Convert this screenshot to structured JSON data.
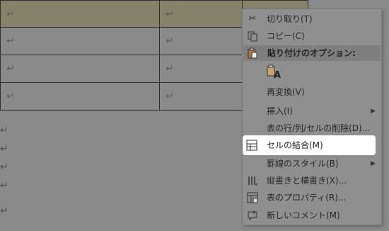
{
  "document": {
    "paragraph_mark": "↵"
  },
  "context_menu": {
    "cut": "切り取り(T)",
    "copy": "コピー(C)",
    "paste_options_header": "貼り付けのオプション:",
    "paste_option_icon": "A",
    "reconvert": "再変換(V)",
    "insert": "挿入(I)",
    "delete_table_parts": "表の行/列/セルの削除(D)...",
    "merge_cells": "セルの結合(M)",
    "border_styles": "罫線のスタイル(B)",
    "text_direction": "縦書きと横書き(X)...",
    "table_properties": "表のプロパティ(R)...",
    "new_comment": "新しいコメント(M)"
  },
  "colors": {
    "highlight": "#ffffff",
    "overlay": "#8a8a8a"
  }
}
